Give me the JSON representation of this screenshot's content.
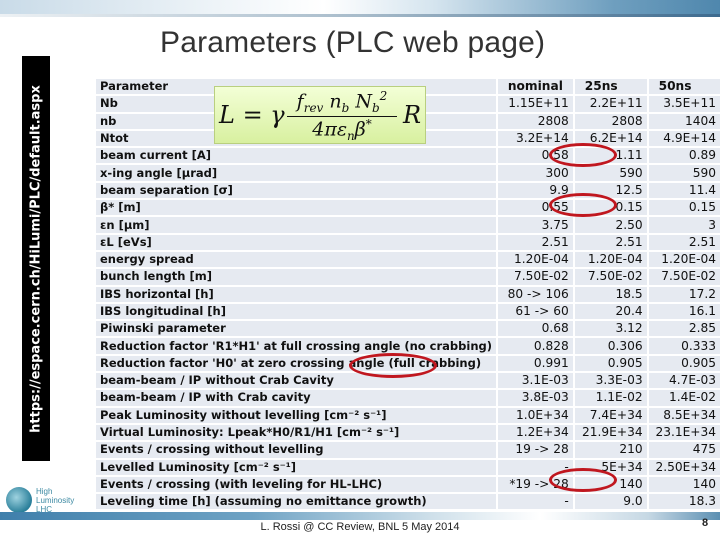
{
  "slide": {
    "title": "Parameters (PLC web page)",
    "side_url": "https://espace.cern.ch/HiLumi/PLC/default.aspx",
    "footer": "L. Rossi @ CC Review, BNL 5 May 2014",
    "page_number": "8",
    "logo": {
      "line1": "High",
      "line2": "Luminosity",
      "line3": "LHC"
    }
  },
  "formula": {
    "lhs": "L = γ",
    "numerator": "f_rev n_b N_b²",
    "numerator_display": "frev nb Nb²",
    "denominator_display": "4πεnβ*",
    "rhs": "R"
  },
  "table": {
    "headers": [
      "Parameter",
      "nominal",
      "25ns",
      "50ns"
    ],
    "rows": [
      {
        "param": "Nb",
        "nominal": "1.15E+11",
        "ns25": "2.2E+11",
        "ns50": "3.5E+11"
      },
      {
        "param": "nb",
        "nominal": "2808",
        "ns25": "2808",
        "ns50": "1404"
      },
      {
        "param": "Ntot",
        "nominal": "3.2E+14",
        "ns25": "6.2E+14",
        "ns50": "4.9E+14"
      },
      {
        "param": "beam current [A]",
        "nominal": "0.58",
        "ns25": "1.11",
        "ns50": "0.89"
      },
      {
        "param": "x-ing angle [μrad]",
        "nominal": "300",
        "ns25": "590",
        "ns50": "590"
      },
      {
        "param": "beam separation [σ]",
        "nominal": "9.9",
        "ns25": "12.5",
        "ns50": "11.4"
      },
      {
        "param": "β* [m]",
        "nominal": "0.55",
        "ns25": "0.15",
        "ns50": "0.15"
      },
      {
        "param": "εn [μm]",
        "nominal": "3.75",
        "ns25": "2.50",
        "ns50": "3"
      },
      {
        "param": "εL [eVs]",
        "nominal": "2.51",
        "ns25": "2.51",
        "ns50": "2.51"
      },
      {
        "param": "energy spread",
        "nominal": "1.20E-04",
        "ns25": "1.20E-04",
        "ns50": "1.20E-04"
      },
      {
        "param": "bunch length [m]",
        "nominal": "7.50E-02",
        "ns25": "7.50E-02",
        "ns50": "7.50E-02"
      },
      {
        "param": "IBS horizontal [h]",
        "nominal": "80 -> 106",
        "ns25": "18.5",
        "ns50": "17.2"
      },
      {
        "param": "IBS longitudinal [h]",
        "nominal": "61 -> 60",
        "ns25": "20.4",
        "ns50": "16.1"
      },
      {
        "param": "Piwinski parameter",
        "nominal": "0.68",
        "ns25": "3.12",
        "ns50": "2.85"
      },
      {
        "param": "Reduction factor 'R1*H1' at full crossing angle (no crabbing)",
        "nominal": "0.828",
        "ns25": "0.306",
        "ns50": "0.333"
      },
      {
        "param": "Reduction factor 'H0' at zero crossing angle (full crabbing)",
        "nominal": "0.991",
        "ns25": "0.905",
        "ns50": "0.905"
      },
      {
        "param": "beam-beam / IP without Crab Cavity",
        "nominal": "3.1E-03",
        "ns25": "3.3E-03",
        "ns50": "4.7E-03"
      },
      {
        "param": "beam-beam / IP with Crab cavity",
        "nominal": "3.8E-03",
        "ns25": "1.1E-02",
        "ns50": "1.4E-02"
      },
      {
        "param": "Peak Luminosity without levelling [cm⁻² s⁻¹]",
        "nominal": "1.0E+34",
        "ns25": "7.4E+34",
        "ns50": "8.5E+34"
      },
      {
        "param": "Virtual Luminosity: Lpeak*H0/R1/H1   [cm⁻² s⁻¹]",
        "nominal": "1.2E+34",
        "ns25": "21.9E+34",
        "ns50": "23.1E+34"
      },
      {
        "param": "Events / crossing without levelling",
        "nominal": "19 -> 28",
        "ns25": "210",
        "ns50": "475"
      },
      {
        "param": "Levelled Luminosity [cm⁻² s⁻¹]",
        "nominal": "-",
        "ns25": "5E+34",
        "ns50": "2.50E+34"
      },
      {
        "param": "Events / crossing (with leveling for HL-LHC)",
        "nominal": "*19 -> 28",
        "ns25": "140",
        "ns50": "140"
      },
      {
        "param": "Leveling time [h] (assuming no emittance growth)",
        "nominal": "-",
        "ns25": "9.0",
        "ns50": "18.3"
      }
    ]
  },
  "highlights": {
    "color": "#c0171f",
    "circled": [
      "beam current 25ns: 1.11",
      "β* 25ns: 0.15",
      "(full crabbing)",
      "Events / crossing with leveling 25ns: 140"
    ]
  }
}
